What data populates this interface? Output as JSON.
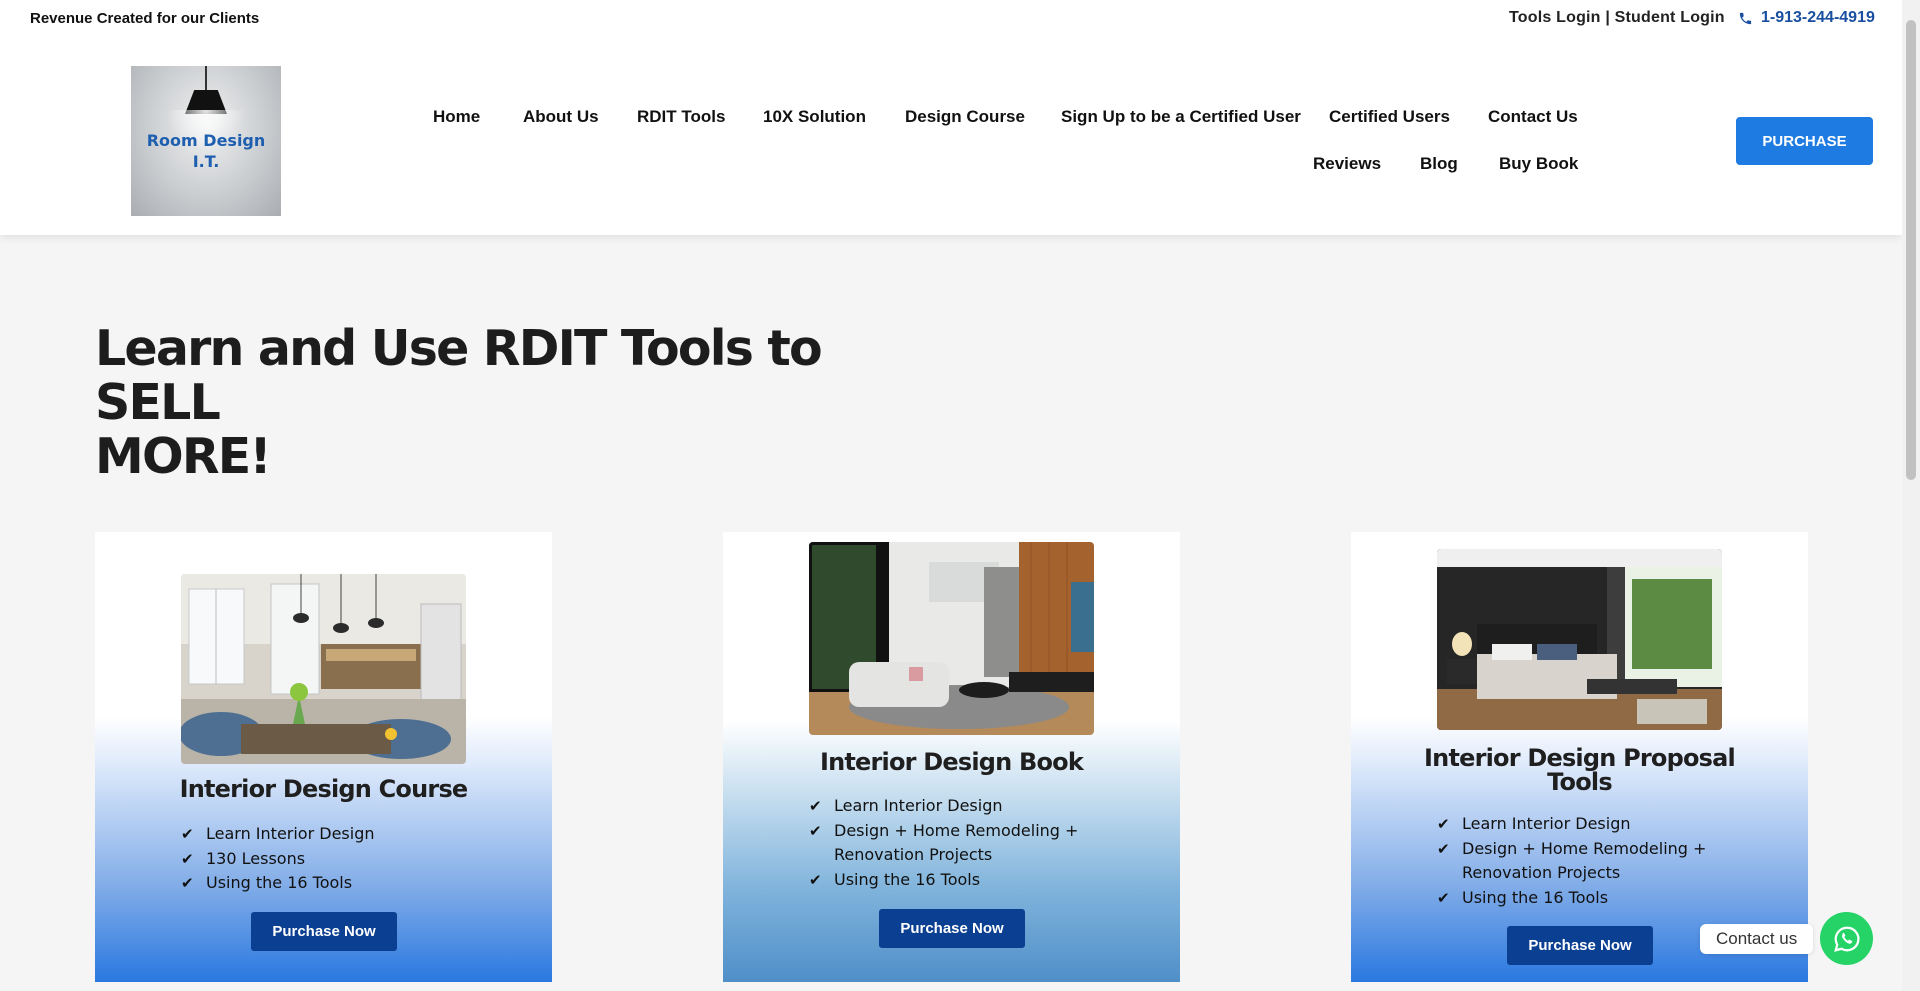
{
  "topbar": {
    "tagline": "Revenue Created for our Clients",
    "tools_login": "Tools Login",
    "separator": " | ",
    "student_login": "Student Login",
    "phone": "1-913-244-4919"
  },
  "logo": {
    "line1": "Room Design",
    "line2": "I.T."
  },
  "nav": {
    "home": "Home",
    "about": "About Us",
    "rdit_tools": "RDIT Tools",
    "solution": "10X Solution",
    "design_course": "Design Course",
    "signup": "Sign Up to be a Certified User",
    "certified": "Certified Users",
    "contact": "Contact Us",
    "reviews": "Reviews",
    "blog": "Blog",
    "buy_book": "Buy Book"
  },
  "purchase_button": "PURCHASE",
  "hero": {
    "line1": "Learn and Use RDIT Tools to SELL",
    "line2": "MORE!"
  },
  "cards": [
    {
      "title": "Interior Design Course",
      "features": [
        "Learn Interior Design",
        "130 Lessons",
        "Using the 16 Tools"
      ],
      "button": "Purchase Now"
    },
    {
      "title": "Interior Design Book",
      "features": [
        "Learn Interior Design",
        "Design + Home Remodeling + Renovation Projects",
        "Using the 16 Tools"
      ],
      "button": "Purchase Now"
    },
    {
      "title_line1": "Interior Design Proposal",
      "title_line2": "Tools",
      "features": [
        "Learn Interior Design",
        "Design + Home Remodeling + Renovation Projects",
        "Using the 16 Tools"
      ],
      "button": "Purchase Now"
    }
  ],
  "contact_widget": {
    "label": "Contact us"
  },
  "icons": {
    "phone": "phone-icon",
    "check": "check-icon",
    "whatsapp": "whatsapp-icon",
    "lamp": "lamp-icon"
  },
  "colors": {
    "accent": "#1e7be2",
    "button_dark": "#0b3f91",
    "phone_link": "#1a4fa0",
    "whatsapp": "#25d366"
  }
}
